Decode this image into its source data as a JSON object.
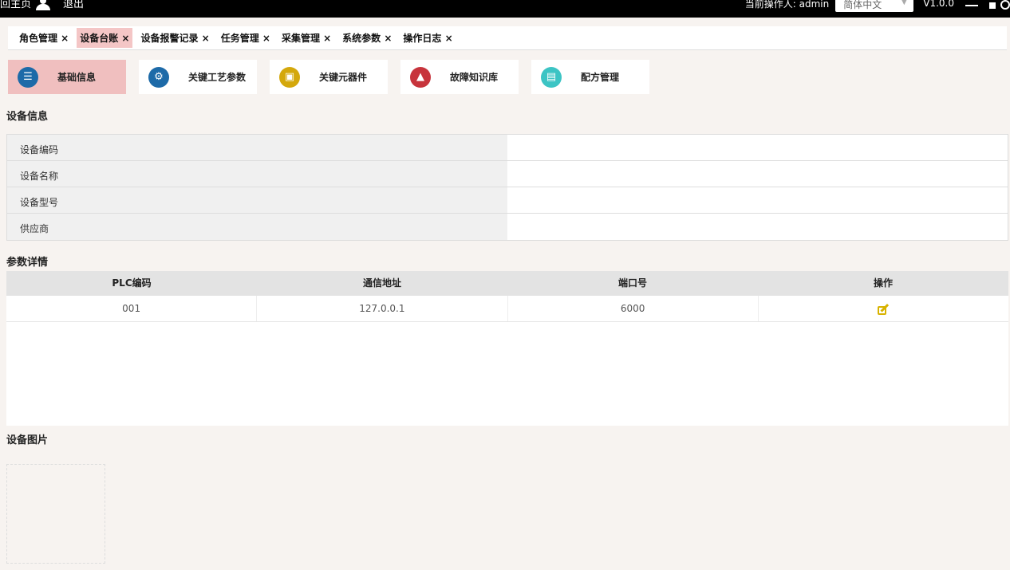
{
  "topbar": {
    "home_label": "回主页",
    "logout_label": "退出",
    "operator_label": "当前操作人: admin",
    "language_value": "简体中文",
    "version": "V1.0.0"
  },
  "tabs": [
    {
      "label": "角色管理 ×"
    },
    {
      "label": "设备台账 ×"
    },
    {
      "label": "设备报警记录 ×"
    },
    {
      "label": "任务管理 ×"
    },
    {
      "label": "采集管理 ×"
    },
    {
      "label": "系统参数 ×"
    },
    {
      "label": "操作日志 ×"
    }
  ],
  "nav": [
    {
      "label": "基础信息",
      "icon": "list-icon"
    },
    {
      "label": "关键工艺参数",
      "icon": "gear-icon"
    },
    {
      "label": "关键元器件",
      "icon": "chip-icon"
    },
    {
      "label": "故障知识库",
      "icon": "warning-icon"
    },
    {
      "label": "配方管理",
      "icon": "save-icon"
    }
  ],
  "device_info": {
    "title": "设备信息",
    "rows": [
      {
        "label": "设备编码",
        "value": ""
      },
      {
        "label": "设备名称",
        "value": ""
      },
      {
        "label": "设备型号",
        "value": ""
      },
      {
        "label": "供应商",
        "value": ""
      }
    ]
  },
  "params": {
    "title": "参数详情",
    "columns": [
      "PLC编码",
      "通信地址",
      "端口号",
      "操作"
    ],
    "rows": [
      {
        "plc": "001",
        "address": "127.0.0.1",
        "port": "6000"
      }
    ]
  },
  "image_section": {
    "title": "设备图片"
  },
  "colors": {
    "active_tab": "#f4c6c6",
    "active_nav": "#f0bfbf",
    "blue": "#1d6aa8",
    "gold": "#d4a80c",
    "red": "#c7343c",
    "teal": "#3cc4c4",
    "edit": "#d8b300"
  }
}
